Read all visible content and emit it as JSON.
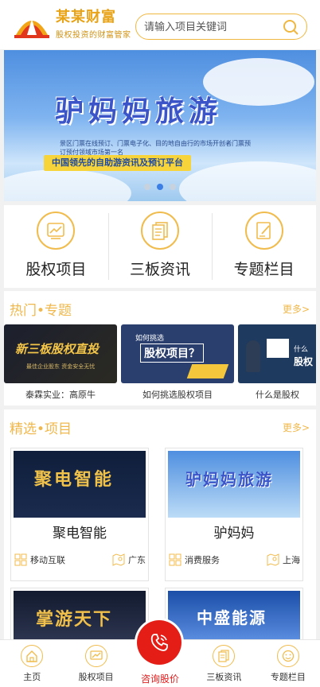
{
  "header": {
    "brand_name": "某某财富",
    "brand_slogan": "股权投资的财富管家",
    "search_placeholder": "请输入项目关键词"
  },
  "banner": {
    "title": "驴妈妈旅游",
    "subtitle": "景区门票在线预订、门票电子化、目的地自由行的市场开创者门票预订预付领域市场第一名",
    "tagline": "中国领先的自助游资讯及预订平台",
    "slides": 3,
    "active_slide": 2
  },
  "quicknav": [
    {
      "label": "股权项目",
      "icon": "chart-icon"
    },
    {
      "label": "三板资讯",
      "icon": "document-icon"
    },
    {
      "label": "专题栏目",
      "icon": "edit-document-icon"
    }
  ],
  "hot_topics": {
    "title": "热门•专题",
    "more": "更多>",
    "items": [
      {
        "caption": "泰霖实业：高原牛",
        "image_text": "新三板股权直投",
        "image_sub": "最佳企业股东 资金安全无忧"
      },
      {
        "caption": "如何挑选股权项目",
        "image_text": "股权项目？",
        "image_top": "如何挑选"
      },
      {
        "caption": "什么是股权",
        "image_text": "股权",
        "image_top": "什么"
      }
    ]
  },
  "projects": {
    "title": "精选•项目",
    "more": "更多>",
    "items": [
      {
        "name": "聚电智能",
        "category": "移动互联",
        "region": "广东",
        "image_text": "聚电智能"
      },
      {
        "name": "驴妈妈",
        "category": "消费服务",
        "region": "上海",
        "image_text": "驴妈妈旅游"
      },
      {
        "name": "掌游天下",
        "image_text": "掌游天下"
      },
      {
        "name": "中盛能源",
        "image_text": "中盛能源"
      }
    ]
  },
  "tabbar": [
    {
      "label": "主页",
      "icon": "home-icon"
    },
    {
      "label": "股权项目",
      "icon": "chart-icon"
    },
    {
      "label": "咨询股价",
      "icon": "phone-icon"
    },
    {
      "label": "三板资讯",
      "icon": "document-icon"
    },
    {
      "label": "专题栏目",
      "icon": "smile-icon"
    }
  ],
  "colors": {
    "accent": "#f0b84c",
    "brand": "#e8a317",
    "call": "#e41e16",
    "banner_dot_active": "#3a7ee6"
  }
}
